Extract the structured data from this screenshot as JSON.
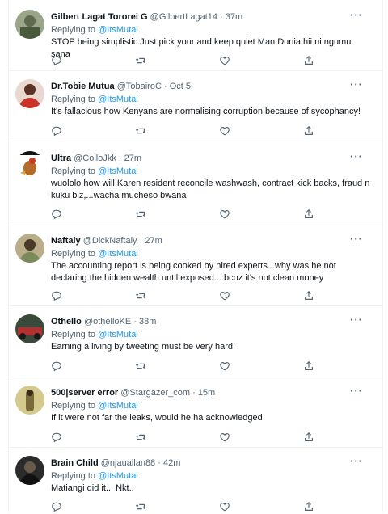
{
  "replying_label": "Replying to",
  "more_label": "···",
  "tweets": [
    {
      "name": "Gilbert Lagat Tororei G",
      "handle": "@GilbertLagat14",
      "time": "· 37m",
      "reply_to": "@ItsMutai",
      "text": "STOP being simplistic.Just pick your and keep quiet Man.Dunia hii ni ngumu sana",
      "avatar_color": "#7a8a6a"
    },
    {
      "name": "Dr.Tobie Mutua",
      "handle": "@TobairoC",
      "time": "· Oct 5",
      "reply_to": "@ItsMutai",
      "text": "It's fallacious how Kenyans are normalising corruption because of sycophancy!",
      "avatar_color": "#c43b2f"
    },
    {
      "name": "Ultra",
      "handle": "@ColloJkk",
      "time": "· 27m",
      "reply_to": "@ItsMutai",
      "text": "wuololo how will Karen resident reconcile washwash, contract kick backs, fraud n kuku biz,...wacha mucheso bwana",
      "avatar_color": "#b8702a"
    },
    {
      "name": "Naftaly",
      "handle": "@DickNaftaly",
      "time": "· 27m",
      "reply_to": "@ItsMutai",
      "text": "The accounting report is being cooked by hired experts...why was he not declaring the hidden wealth until exposed... bcoz it's not clean money",
      "avatar_color": "#8a7a4a"
    },
    {
      "name": "Othello",
      "handle": "@othelloKE",
      "time": "· 38m",
      "reply_to": "@ItsMutai",
      "text": "Earning a living by tweeting must be very hard.",
      "avatar_color": "#6a3a3a"
    },
    {
      "name": "500|server error",
      "handle": "@Stargazer_com",
      "time": "· 15m",
      "reply_to": "@ItsMutai",
      "text": "If it were not far the leaks, would he ha acknowledged",
      "avatar_color": "#9a8a5a"
    },
    {
      "name": "Brain Child",
      "handle": "@njauallan88",
      "time": "· 42m",
      "reply_to": "@ItsMutai",
      "text": "Matiangi did it... Nkt..",
      "avatar_color": "#2a2a2a"
    }
  ]
}
